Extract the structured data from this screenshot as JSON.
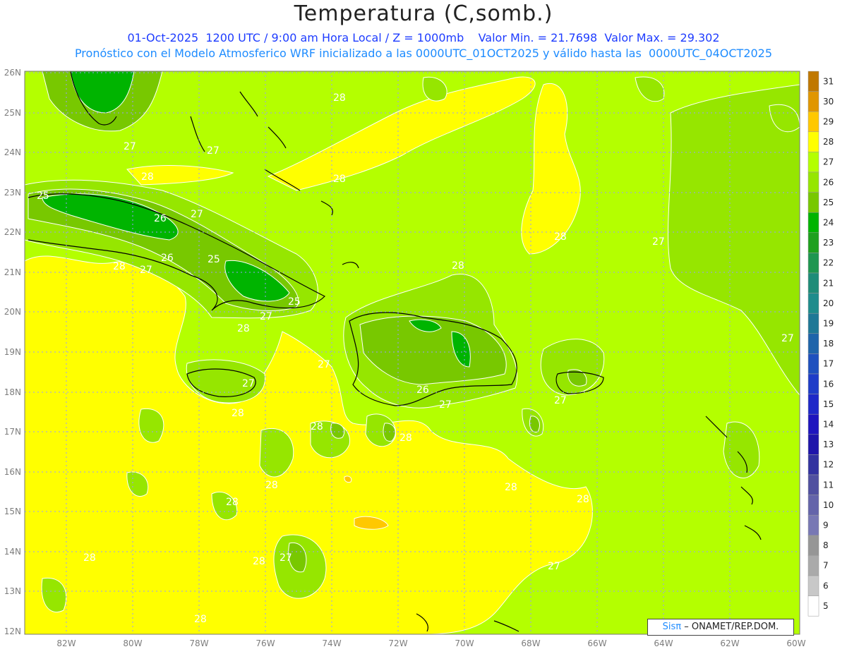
{
  "title": "Temperatura (C,somb.)",
  "subtitle_1": "01-Oct-2025  1200 UTC / 9:00 am Hora Local / Z = 1000mb    Valor Min. = 21.7698  Valor Max. = 29.302",
  "subtitle_2": "Pronóstico con el Modelo Atmosferico WRF inicializado a las 0000UTC_01OCT2025 y válido hasta las  0000UTC_04OCT2025",
  "lat_labels": [
    "26N",
    "25N",
    "24N",
    "23N",
    "22N",
    "21N",
    "20N",
    "19N",
    "18N",
    "17N",
    "16N",
    "15N",
    "14N",
    "13N",
    "12N"
  ],
  "lon_labels": [
    "82W",
    "80W",
    "78W",
    "76W",
    "74W",
    "72W",
    "70W",
    "68W",
    "66W",
    "64W",
    "62W",
    "60W"
  ],
  "colorbar": {
    "labels": [
      "31",
      "30",
      "29",
      "28",
      "27",
      "26",
      "25",
      "24",
      "23",
      "22",
      "21",
      "20",
      "19",
      "18",
      "17",
      "16",
      "15",
      "14",
      "13",
      "12",
      "11",
      "10",
      "9",
      "8",
      "7",
      "6",
      "5"
    ],
    "colors": [
      "#c07800",
      "#e09600",
      "#ffc800",
      "#ffff00",
      "#b4ff00",
      "#96e600",
      "#78c800",
      "#00b400",
      "#1ea01e",
      "#1e9650",
      "#1e8c78",
      "#1e8c8c",
      "#1e7896",
      "#1e64aa",
      "#1e50be",
      "#1e3cc8",
      "#1e28c8",
      "#1e14be",
      "#1e14aa",
      "#3232a0",
      "#5050a0",
      "#6464aa",
      "#7878b4",
      "#969696",
      "#aaaaaa",
      "#c8c8c8",
      "#ffffff"
    ]
  },
  "contour_labels": [
    "27",
    "28",
    "28",
    "27",
    "28",
    "25",
    "26",
    "27",
    "28",
    "26",
    "25",
    "27",
    "28",
    "27",
    "28",
    "28",
    "25",
    "26",
    "27",
    "27",
    "27",
    "28",
    "27",
    "28",
    "27",
    "28",
    "28",
    "27",
    "28",
    "27",
    "28",
    "28",
    "28",
    "28",
    "27",
    "28"
  ],
  "credit": {
    "logo": "Sisπ",
    "text": "– ONAMET/REP.DOM."
  },
  "palette": {
    "yellow": "#ffff00",
    "lime": "#b4ff00",
    "green_light": "#96e600",
    "green_mid": "#78c800",
    "green_dark": "#00b400",
    "green_deep": "#1ea01e",
    "orange": "#e09600"
  }
}
